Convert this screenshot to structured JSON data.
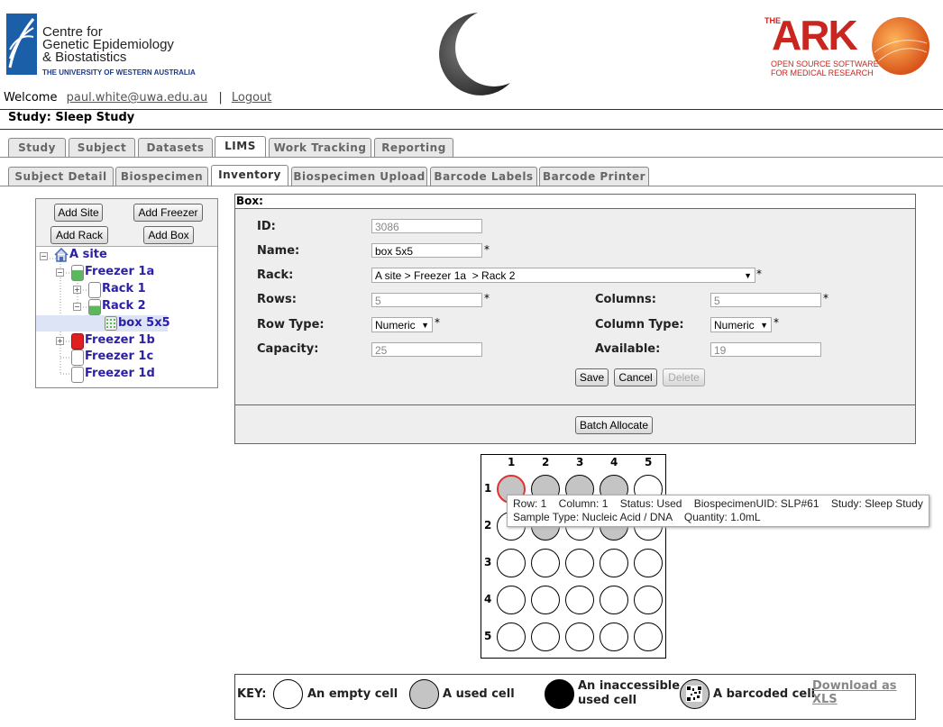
{
  "header": {
    "cgeb_line1": "Centre for",
    "cgeb_line2": "Genetic Epidemiology",
    "cgeb_line3": "& Biostatistics",
    "uwa_text": "THE UNIVERSITY OF WESTERN AUSTRALIA",
    "ark_the": "THE",
    "ark_name": "ARK",
    "ark_tag1": "OPEN SOURCE SOFTWARE",
    "ark_tag2": "FOR MEDICAL RESEARCH",
    "welcome_label": "Welcome",
    "user_email": "paul.white@uwa.edu.au",
    "separator": "|",
    "logout": "Logout"
  },
  "study_title": "Study: Sleep Study",
  "main_tabs": [
    {
      "label": "Study"
    },
    {
      "label": "Subject"
    },
    {
      "label": "Datasets"
    },
    {
      "label": "LIMS"
    },
    {
      "label": "Work Tracking"
    },
    {
      "label": "Reporting"
    }
  ],
  "sub_tabs": [
    {
      "label": "Subject Detail"
    },
    {
      "label": "Biospecimen"
    },
    {
      "label": "Inventory"
    },
    {
      "label": "Biospecimen Upload"
    },
    {
      "label": "Barcode Labels"
    },
    {
      "label": "Barcode Printer"
    }
  ],
  "tree_panel": {
    "buttons": {
      "add_site": "Add Site",
      "add_freezer": "Add Freezer",
      "add_rack": "Add Rack",
      "add_box": "Add Box"
    },
    "nodes": {
      "site": "A site",
      "freezer_1a": "Freezer 1a",
      "rack_1": "Rack 1",
      "rack_2": "Rack 2",
      "box": "box 5x5",
      "freezer_1b": "Freezer 1b",
      "freezer_1c": "Freezer 1c",
      "freezer_1d": "Freezer 1d"
    }
  },
  "box_form": {
    "title": "Box:",
    "id_label": "ID:",
    "id_value": "3086",
    "name_label": "Name:",
    "name_value": "box 5x5",
    "rack_label": "Rack:",
    "rack_value": "A site > Freezer 1a  > Rack 2",
    "rows_label": "Rows:",
    "rows_value": "5",
    "columns_label": "Columns:",
    "columns_value": "5",
    "row_type_label": "Row Type:",
    "row_type_value": "Numeric",
    "column_type_label": "Column Type:",
    "column_type_value": "Numeric",
    "capacity_label": "Capacity:",
    "capacity_value": "25",
    "available_label": "Available:",
    "available_value": "19",
    "required_mark": "*",
    "save": "Save",
    "cancel": "Cancel",
    "delete": "Delete",
    "batch_allocate": "Batch Allocate"
  },
  "grid": {
    "column_labels": [
      "1",
      "2",
      "3",
      "4",
      "5"
    ],
    "row_labels": [
      "1",
      "2",
      "3",
      "4",
      "5"
    ],
    "used_cells": [
      [
        1,
        1
      ],
      [
        1,
        2
      ],
      [
        1,
        3
      ],
      [
        1,
        4
      ],
      [
        2,
        2
      ],
      [
        2,
        4
      ]
    ],
    "selected_cell": [
      1,
      1
    ],
    "tooltip_line1": "Row: 1    Column: 1    Status: Used    BiospecimenUID: SLP#61    Study: Sleep Study",
    "tooltip_line2": "Sample Type: Nucleic Acid / DNA    Quantity: 1.0mL"
  },
  "key": {
    "label": "KEY:",
    "empty": "An empty cell",
    "used": "A used cell",
    "inaccessible_1": "An inaccessible",
    "inaccessible_2": "used cell",
    "barcoded": "A barcoded cell",
    "download_1": "Download as",
    "download_2": "XLS"
  },
  "colors": {
    "tree_link": "#2b1fa6",
    "freezer_green": "#5cb85c",
    "freezer_red": "#e02020",
    "ark_red": "#c8261e",
    "ark_orange": "#e8731a",
    "cgeb_blue": "#1a5fa8"
  }
}
